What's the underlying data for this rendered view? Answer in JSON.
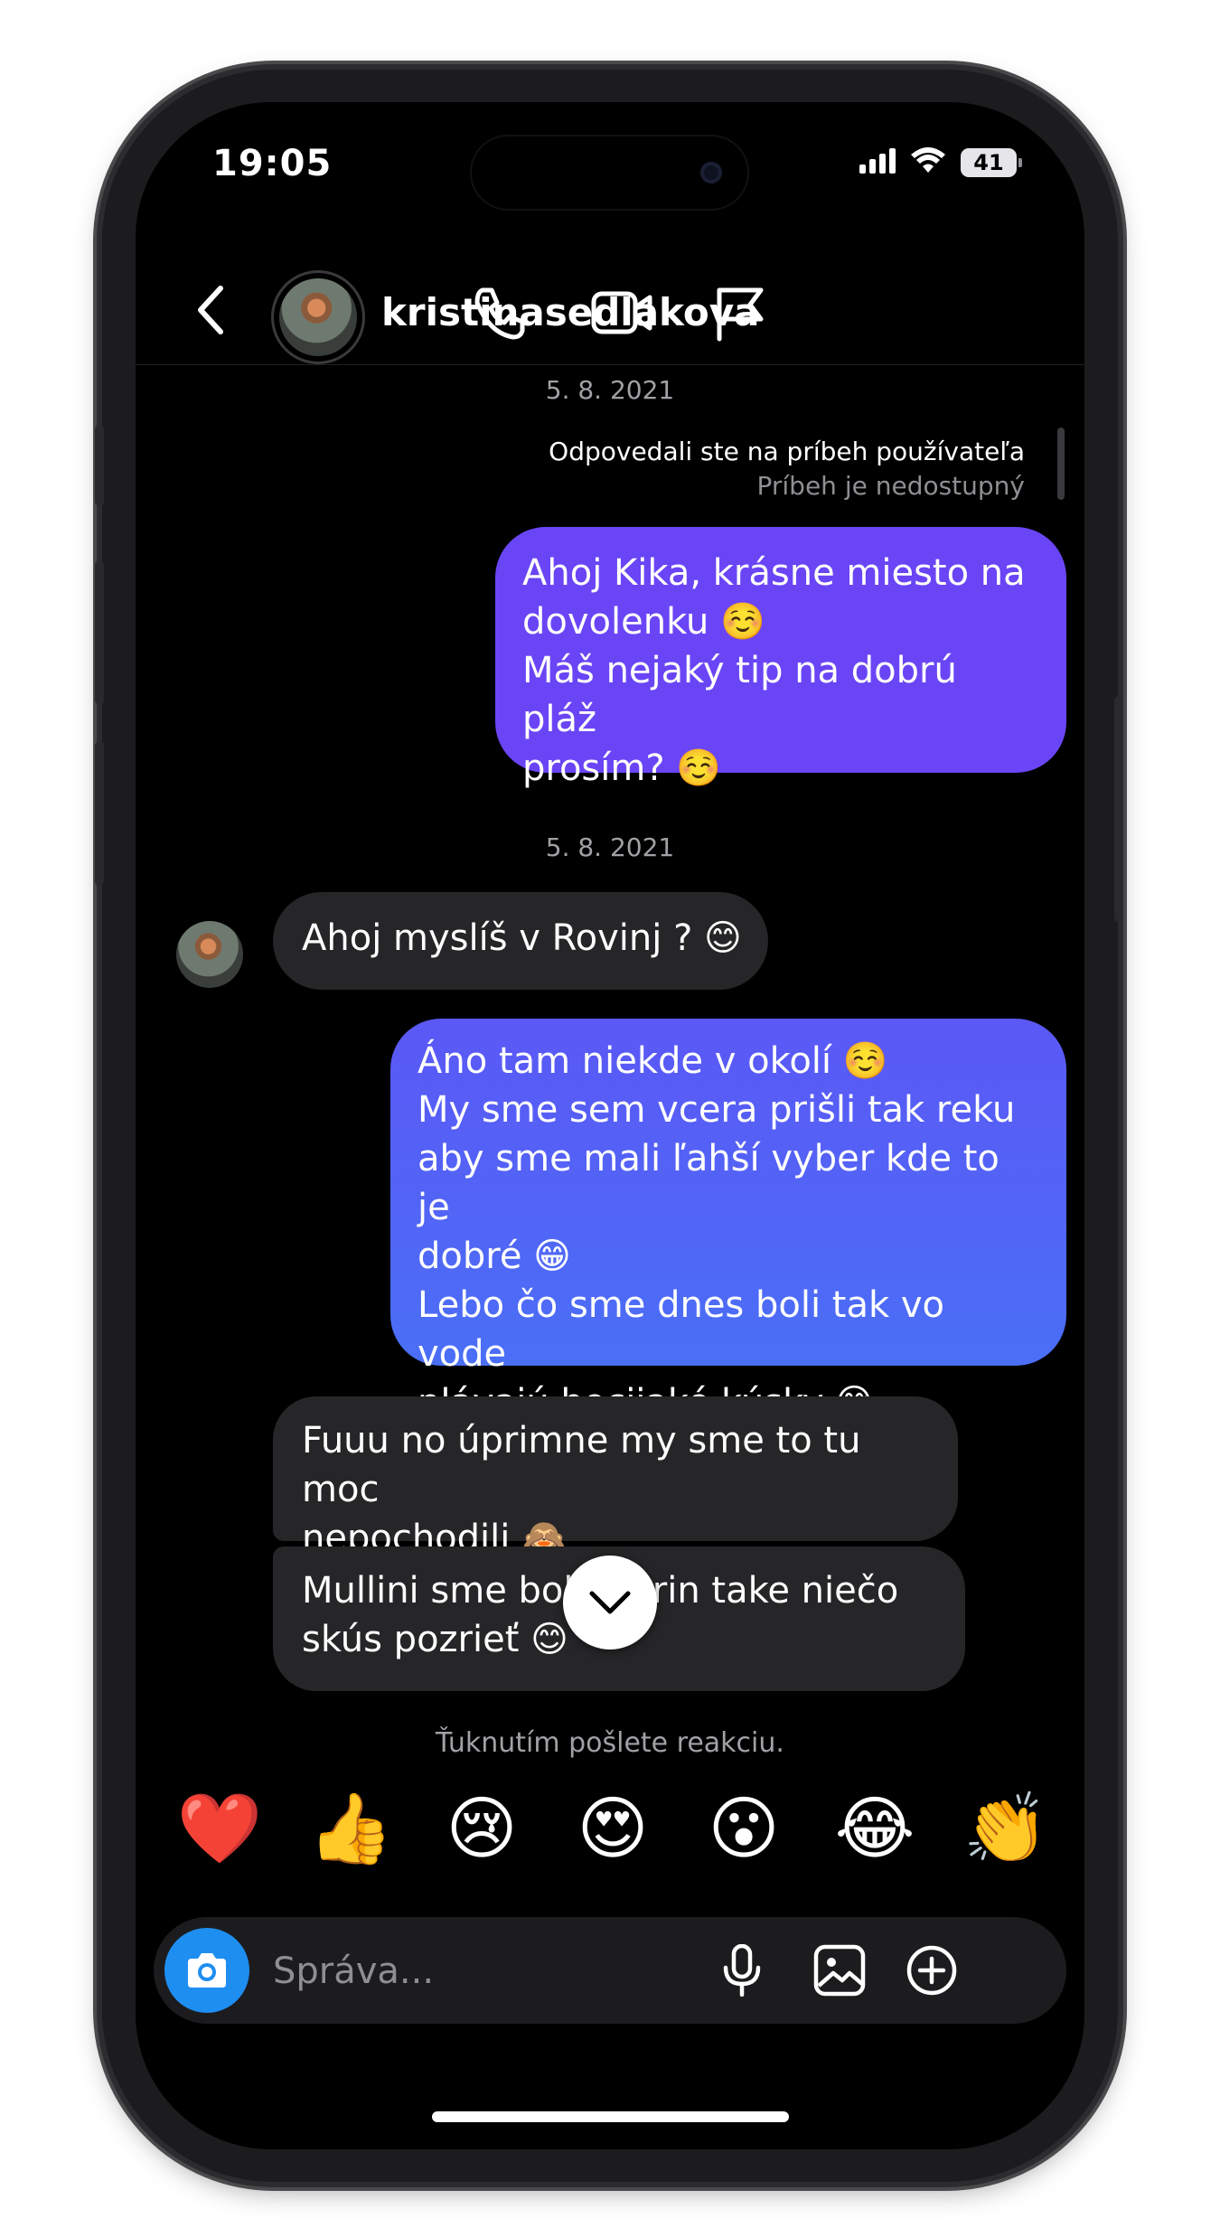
{
  "status_bar": {
    "time": "19:05",
    "battery": "41"
  },
  "header": {
    "username": "kristinasedlakova",
    "icons": [
      "back-chevron-icon",
      "phone-icon",
      "video-camera-icon",
      "flag-icon"
    ]
  },
  "thread": {
    "date_1": "5. 8. 2021",
    "story_reply": {
      "note": "Odpovedali ste na príbeh používateľa",
      "unavailable": "Príbeh je nedostupný"
    },
    "outgoing_1": {
      "line_1": "Ahoj Kika, krásne miesto na",
      "line_2": "dovolenku ☺️",
      "line_3": "Máš nejaký tip na dobrú pláž",
      "line_4": "prosím? ☺️"
    },
    "date_2": "5. 8. 2021",
    "incoming_1": "Ahoj myslíš v Rovinj ? 😊",
    "outgoing_2": {
      "line_1": "Áno tam niekde v okolí ☺️",
      "line_2": "My sme sem vcera prišli tak reku",
      "line_3": "aby sme mali ľahší vyber kde to je",
      "line_4": "dobré 😁",
      "line_5": "Lebo čo sme dnes boli tak vo vode",
      "line_6": "plávajú hocijaké kúsky 😅"
    },
    "incoming_2": {
      "line_1": "Fuuu no úprimne my sme to tu moc",
      "line_2": "nepochodili 🙈"
    },
    "incoming_3": {
      "line_1": "Mullini sme boli marin take niečo",
      "line_2": "skús pozrieť 😊"
    }
  },
  "reactions": {
    "hint": "Ťuknutím pošlete reakciu.",
    "items": [
      "❤️",
      "👍",
      "😢",
      "😍",
      "😮",
      "😂",
      "👏"
    ]
  },
  "composer": {
    "placeholder": "Správa...",
    "icons": [
      "camera-icon",
      "microphone-icon",
      "gallery-icon",
      "plus-circle-icon"
    ]
  },
  "colors": {
    "outgoing_purple": "#6a45f5",
    "outgoing_blue": "#4a6ff6",
    "incoming_bubble": "#262628",
    "camera_button": "#1f8ef1",
    "background": "#000000"
  }
}
